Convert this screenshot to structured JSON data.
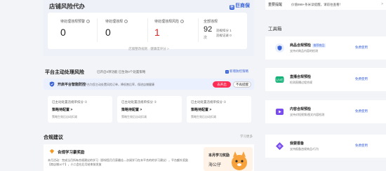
{
  "shop_risk": {
    "title": "店铺风险代办",
    "brand": "巨商保",
    "stats": [
      {
        "label": "待处理违规预警",
        "value": "0"
      },
      {
        "label": "待处理违规",
        "value": "0"
      },
      {
        "label": "待处理违规风险",
        "value": "1"
      }
    ],
    "total": {
      "label": "全部违规",
      "value": "92",
      "unit": "次",
      "counts": [
        "违规扣分 1",
        "违规记录 0"
      ]
    },
    "view_more": "店铺整改规则 · 健康度评分 >"
  },
  "active_risk": {
    "title": "平台主动处理风险",
    "subtitle": "已开启0项功能  已生效0个处置策略",
    "new_feature": "新增防控策略",
    "smart_bar": {
      "title": "开启平台智能防控",
      "text": "平台为您主动处置风险订单，降低售后率，保进店铺健康",
      "open": "去开启",
      "skip": "不再提醒"
    },
    "strategies": [
      {
        "label": "已主动处置违规单扣分 ①",
        "value": "策略待配置 >",
        "desc": "策略生效后自动扣减"
      },
      {
        "label": "已主动处置违规单扣分 ①",
        "value": "策略待配置 >",
        "desc": "策略生效后自动扣减"
      },
      {
        "label": "已主动处置违规单扣分 ①",
        "value": "策略待配置 >",
        "desc": "策略生效后自动扣减"
      }
    ]
  },
  "compliance": {
    "title": "合规建议",
    "link": "学习更多",
    "card_title": "合规学习豪奖励",
    "card_text": "本月活动：完成当月所有合规建议的学习（即如您月月获最佳—次阅学习在本平合的的学习建议），平台额外奖励【商店铺10个】，小二会在后月结束前发放",
    "promo_line1": "本月学习奖励",
    "promo_line2": "海公仔"
  },
  "notice": {
    "tag": "重要提醒",
    "text": "价值999+条米读提醒，请前往查看！",
    "arrow": ">"
  },
  "toolbox": {
    "title": "工具箱",
    "items": [
      {
        "name": "商品合规预检",
        "badge": "推荐商品",
        "desc": "支持对商品内容的检测",
        "link": "免费使用",
        "color": "#3b63d8",
        "icon": "shield-icon"
      },
      {
        "name": "直播合规预检",
        "badge": "",
        "desc": "检测直播过程合规",
        "link": "免费使用",
        "color": "#15b37a",
        "icon": "live-icon"
      },
      {
        "name": "内容合规预检",
        "badge": "",
        "desc": "支持对短视频/图文内容检测",
        "link": "免费使用",
        "color": "#7a4cf0",
        "icon": "play-icon"
      },
      {
        "name": "我要报备",
        "badge": "",
        "desc": "支持报备违规商品/行为",
        "link": "免费使用",
        "color": "#7a4cf0",
        "icon": "report-icon"
      }
    ]
  }
}
